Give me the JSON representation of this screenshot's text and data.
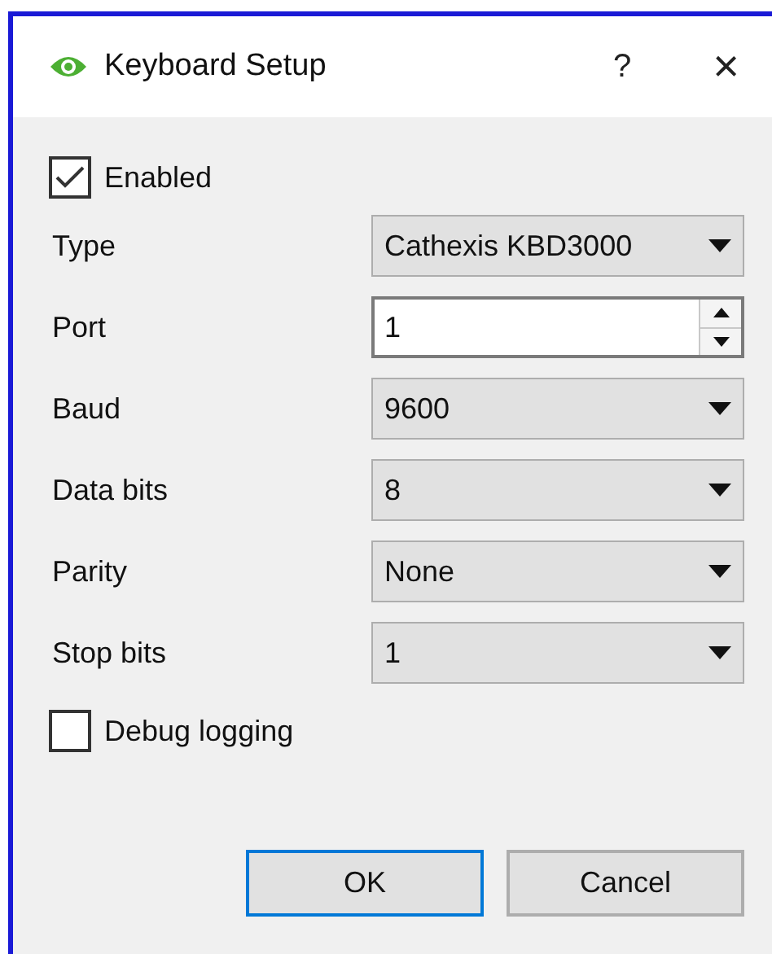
{
  "window": {
    "title": "Keyboard Setup",
    "help": "?",
    "close": "×"
  },
  "enabled": {
    "label": "Enabled",
    "checked": true
  },
  "fields": [
    {
      "label": "Type",
      "kind": "combo",
      "value": "Cathexis KBD3000"
    },
    {
      "label": "Port",
      "kind": "spin",
      "value": "1"
    },
    {
      "label": "Baud",
      "kind": "combo",
      "value": "9600"
    },
    {
      "label": "Data bits",
      "kind": "combo",
      "value": "8"
    },
    {
      "label": "Parity",
      "kind": "combo",
      "value": "None"
    },
    {
      "label": "Stop bits",
      "kind": "combo",
      "value": "1"
    }
  ],
  "debug": {
    "label": "Debug logging",
    "checked": false
  },
  "buttons": [
    {
      "label": "OK",
      "default": true
    },
    {
      "label": "Cancel",
      "default": false
    }
  ]
}
